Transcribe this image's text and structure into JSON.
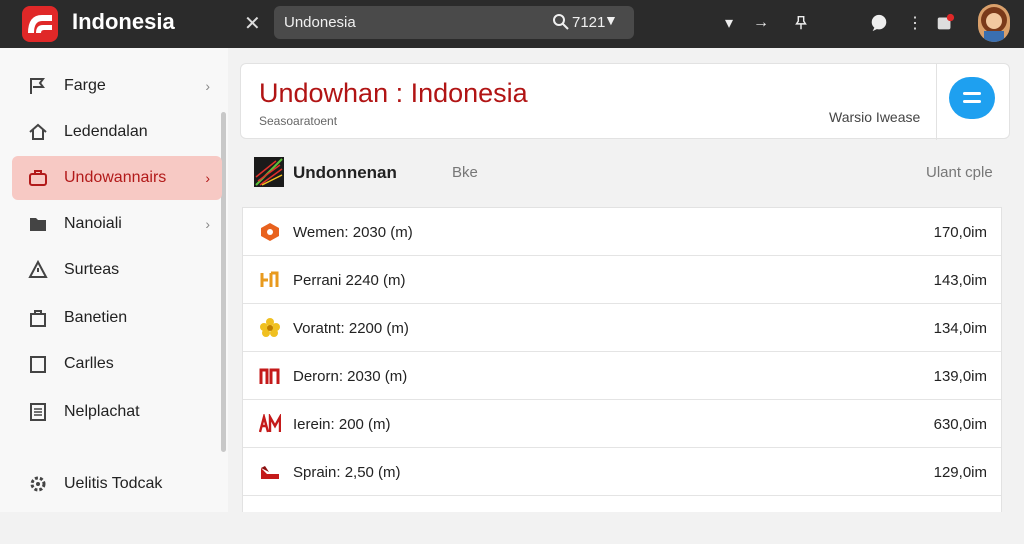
{
  "app": {
    "title": "Indonesia"
  },
  "search": {
    "value": "Undonesia",
    "count": "7121"
  },
  "sidebar": {
    "items": [
      {
        "label": "Farge",
        "icon": "flag-icon"
      },
      {
        "label": "Ledendalan",
        "icon": "home-icon"
      },
      {
        "label": "Undowannairs",
        "icon": "briefcase-icon"
      },
      {
        "label": "Nanoiali",
        "icon": "folder-icon"
      },
      {
        "label": "Surteas",
        "icon": "alert-icon"
      },
      {
        "label": "Banetien",
        "icon": "bag-icon"
      },
      {
        "label": "Carlles",
        "icon": "square-icon"
      },
      {
        "label": "Nelplachat",
        "icon": "document-icon"
      }
    ],
    "footer_label": "Uelitis Todcak"
  },
  "header": {
    "title": "Undowhan : Indonesia",
    "subtitle": "Seasoaratoent",
    "right_text": "Warsio Iwease"
  },
  "section": {
    "title": "Undonnenan",
    "column": "Bke",
    "right_label": "Ulant cple"
  },
  "rows": [
    {
      "label": "Wemen: 2030 (m)",
      "value": "170,0im",
      "icon": "orange-hex-icon"
    },
    {
      "label": "Perrani 2240 (m)",
      "value": "143,0im",
      "icon": "orange-glyph-icon"
    },
    {
      "label": "Voratnt: 2200 (m)",
      "value": "134,0im",
      "icon": "yellow-flower-icon"
    },
    {
      "label": "Derorn: 2030 (m)",
      "value": "139,0im",
      "icon": "red-glyph-icon"
    },
    {
      "label": "Ierein: 200 (m)",
      "value": "630,0im",
      "icon": "red-letters-icon"
    },
    {
      "label": "Sprain: 2,50 (m)",
      "value": "129,0im",
      "icon": "red-shoe-icon"
    }
  ]
}
